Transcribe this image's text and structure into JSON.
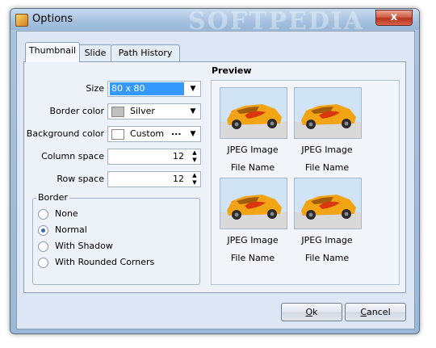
{
  "window": {
    "title": "Options",
    "watermark": "SOFTPEDIA",
    "close_glyph": "x"
  },
  "tabs": [
    {
      "label": "Thumbnail",
      "active": true
    },
    {
      "label": "Slide",
      "active": false
    },
    {
      "label": "Path History",
      "active": false
    }
  ],
  "thumbnail": {
    "size_label": "Size",
    "size_value": "80 x 80",
    "border_color_label": "Border color",
    "border_color_value": "Silver",
    "background_color_label": "Background color",
    "background_color_value": "Custom",
    "background_color_more": "...",
    "column_space_label": "Column space",
    "column_space_value": "12",
    "row_space_label": "Row space",
    "row_space_value": "12",
    "border_group": {
      "title": "Border",
      "options": [
        {
          "label": "None",
          "checked": false
        },
        {
          "label": "Normal",
          "checked": true
        },
        {
          "label": "With Shadow",
          "checked": false
        },
        {
          "label": "With Rounded Corners",
          "checked": false
        }
      ]
    }
  },
  "preview": {
    "title": "Preview",
    "items": [
      {
        "type_label": "JPEG Image",
        "name_label": "File Name"
      },
      {
        "type_label": "JPEG Image",
        "name_label": "File Name"
      },
      {
        "type_label": "JPEG Image",
        "name_label": "File Name"
      },
      {
        "type_label": "JPEG Image",
        "name_label": "File Name"
      }
    ]
  },
  "buttons": {
    "ok_first": "O",
    "ok_rest": "k",
    "cancel_first": "C",
    "cancel_rest": "ancel"
  },
  "icons": {
    "dropdown": "chevron-down-icon",
    "spin_up": "arrow-up-icon",
    "spin_down": "arrow-down-icon",
    "color_swatch": "color-swatch-icon"
  },
  "colors": {
    "border_color_swatch": "#c0c0c0",
    "selection": "#3399ff",
    "radio_dot": "#2f6db4",
    "close": "#c8432a"
  }
}
